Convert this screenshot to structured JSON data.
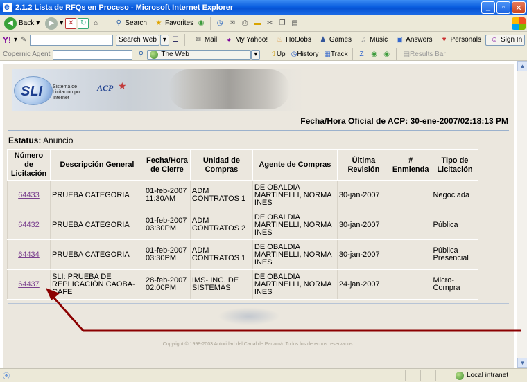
{
  "window": {
    "title": "2.1.2 Lista de RFQs en Proceso - Microsoft Internet Explorer"
  },
  "toolbar": {
    "back_label": "Back",
    "search_label": "Search",
    "favorites_label": "Favorites"
  },
  "yahoo_bar": {
    "search_web_label": "Search Web",
    "mail_label": "Mail",
    "my_yahoo_label": "My Yahoo!",
    "hotjobs_label": "HotJobs",
    "games_label": "Games",
    "music_label": "Music",
    "answers_label": "Answers",
    "personals_label": "Personals",
    "signin_label": "Sign In"
  },
  "copernic_bar": {
    "label": "Copernic Agent",
    "scope_value": "The Web",
    "up_label": "Up",
    "history_label": "History",
    "track_label": "Track",
    "results_label": "Results Bar"
  },
  "header": {
    "logo_text": "SLI",
    "logo_caption": "Sistema de Licitación por Internet",
    "acp_text": "ACP",
    "fecha_label": "Fecha/Hora Oficial de ACP:",
    "fecha_value": "30-ene-2007/02:18:13 PM"
  },
  "estatus": {
    "label": "Estatus:",
    "value": "Anuncio"
  },
  "table": {
    "headers": [
      "Número de Licitación",
      "Descripción General",
      "Fecha/Hora de Cierre",
      "Unidad de Compras",
      "Agente de Compras",
      "Última Revisión",
      "# Enmienda",
      "Tipo de Licitación"
    ],
    "rows": [
      {
        "num": "64433",
        "desc": "PRUEBA CATEGORIA",
        "cierre": "01-feb-2007 11:30AM",
        "unidad": "ADM CONTRATOS 1",
        "agente": "DE OBALDIA MARTINELLI, NORMA INES",
        "revision": "30-jan-2007",
        "enmienda": "",
        "tipo": "Negociada"
      },
      {
        "num": "64432",
        "desc": "PRUEBA CATEGORIA",
        "cierre": "01-feb-2007 03:30PM",
        "unidad": "ADM CONTRATOS 2",
        "agente": "DE OBALDIA MARTINELLI, NORMA INES",
        "revision": "30-jan-2007",
        "enmienda": "",
        "tipo": "Pública"
      },
      {
        "num": "64434",
        "desc": "PRUEBA CATEGORIA",
        "cierre": "01-feb-2007 03:30PM",
        "unidad": "ADM CONTRATOS 1",
        "agente": "DE OBALDIA MARTINELLI, NORMA INES",
        "revision": "30-jan-2007",
        "enmienda": "",
        "tipo": "Pública Presencial"
      },
      {
        "num": "64437",
        "desc": "SLI: PRUEBA DE REPLICACIÓN CAOBA-CAFE",
        "cierre": "28-feb-2007 02:00PM",
        "unidad": "IMS- ING. DE SISTEMAS",
        "agente": "DE OBALDIA MARTINELLI, NORMA INES",
        "revision": "24-jan-2007",
        "enmienda": "",
        "tipo": "Micro-Compra"
      }
    ]
  },
  "footer": {
    "copyright": "Copyright © 1998-2003 Autoridad del Canal de Panamá. Todos los derechos reservados."
  },
  "statusbar": {
    "zone_label": "Local intranet"
  },
  "colors": {
    "link_visited": "#7a3f8e",
    "annotation_arrow": "#8b0000",
    "page_bg": "#ebe7de"
  }
}
